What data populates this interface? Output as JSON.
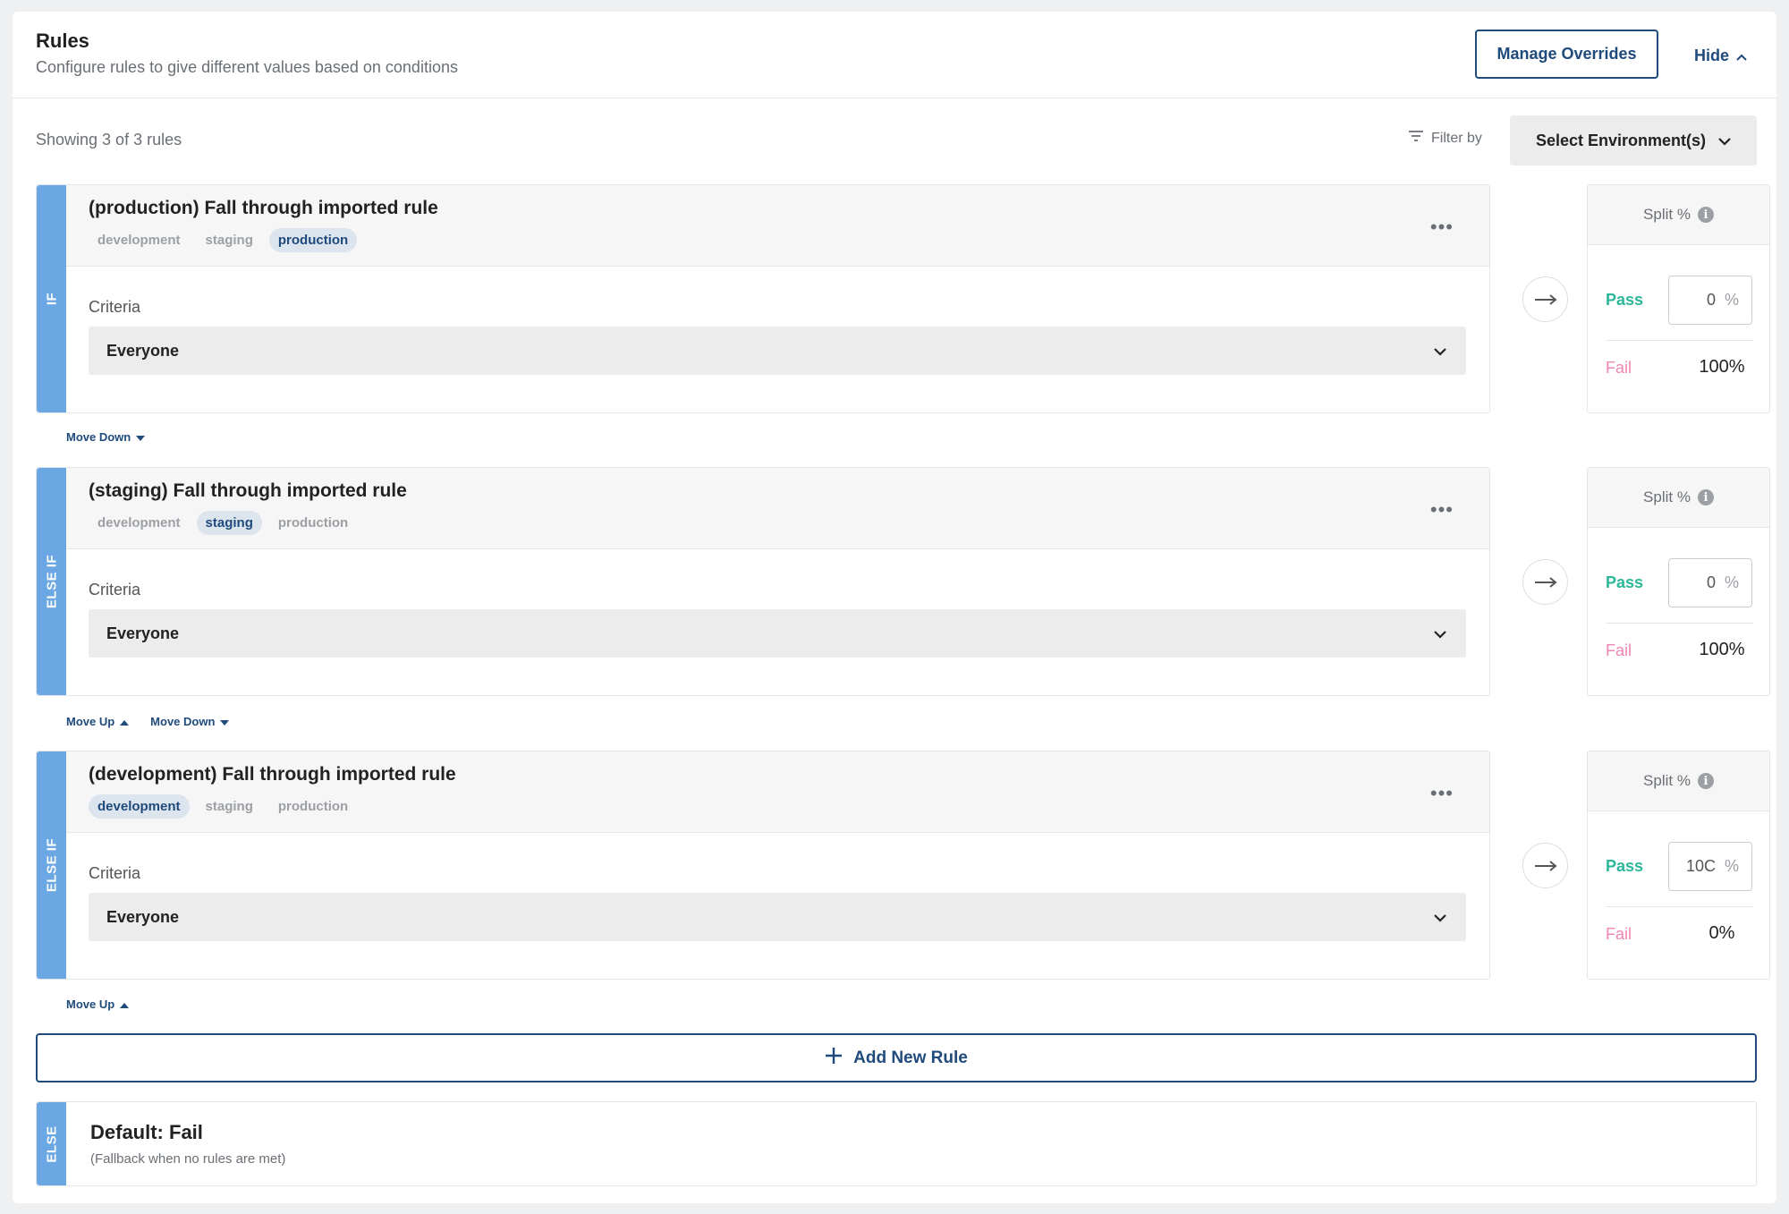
{
  "header": {
    "title": "Rules",
    "subtitle": "Configure rules to give different values based on conditions",
    "manage_overrides": "Manage Overrides",
    "hide": "Hide"
  },
  "toolbar": {
    "showing": "Showing 3 of 3 rules",
    "filter_by": "Filter by",
    "env_select": "Select Environment(s)"
  },
  "rules": [
    {
      "kind": "IF",
      "title": "(production) Fall through imported rule",
      "tags": [
        "development",
        "staging",
        "production"
      ],
      "active_tag": "production",
      "criteria_label": "Criteria",
      "criteria_value": "Everyone",
      "split_label": "Split %",
      "pass_label": "Pass",
      "pass_value": "0",
      "fail_label": "Fail",
      "fail_value": "100%"
    },
    {
      "kind": "ELSE IF",
      "title": "(staging) Fall through imported rule",
      "tags": [
        "development",
        "staging",
        "production"
      ],
      "active_tag": "staging",
      "criteria_label": "Criteria",
      "criteria_value": "Everyone",
      "split_label": "Split %",
      "pass_label": "Pass",
      "pass_value": "0",
      "fail_label": "Fail",
      "fail_value": "100%"
    },
    {
      "kind": "ELSE IF",
      "title": "(development) Fall through imported rule",
      "tags": [
        "development",
        "staging",
        "production"
      ],
      "active_tag": "development",
      "criteria_label": "Criteria",
      "criteria_value": "Everyone",
      "split_label": "Split %",
      "pass_label": "Pass",
      "pass_value": "10C",
      "fail_label": "Fail",
      "fail_value": "0%"
    }
  ],
  "pct_sign": "%",
  "move": {
    "down": "Move Down",
    "up": "Move Up"
  },
  "add_rule": "Add New Rule",
  "else": {
    "kind": "ELSE",
    "title": "Default: Fail",
    "subtitle": "(Fallback when no rules are met)"
  },
  "colors": {
    "primary": "#1f4a7c",
    "bar": "#6aa7e3",
    "pass": "#2bb79a",
    "fail": "#ef85b4"
  },
  "icons": [
    "chevron-up-icon",
    "filter-icon",
    "chevron-down-icon",
    "more-icon",
    "arrow-right-icon",
    "info-icon",
    "caret-down-icon",
    "caret-up-icon",
    "plus-icon"
  ]
}
